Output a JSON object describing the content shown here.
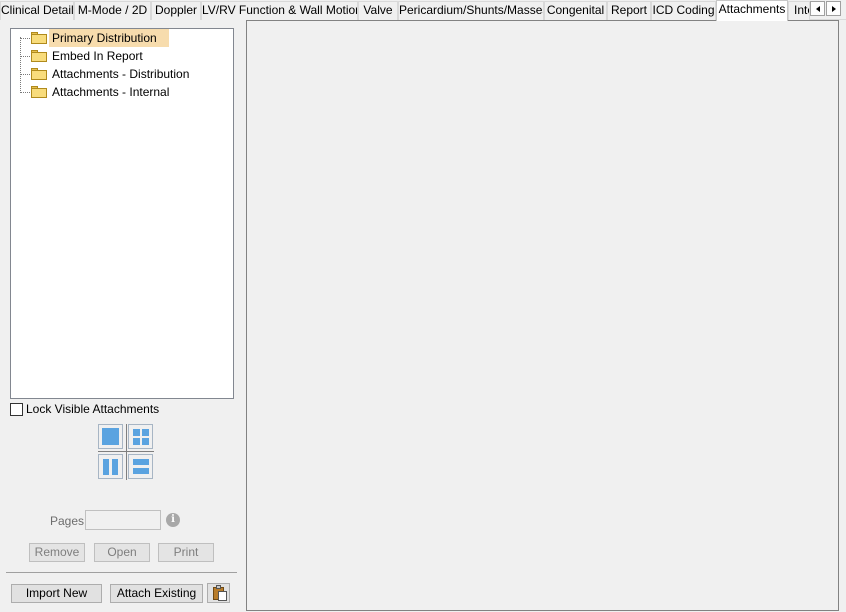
{
  "tabs": [
    {
      "label": "Clinical Detail",
      "active": false
    },
    {
      "label": "M-Mode / 2D",
      "active": false
    },
    {
      "label": "Doppler",
      "active": false
    },
    {
      "label": "LV/RV Function & Wall Motion",
      "active": false
    },
    {
      "label": "Valve",
      "active": false
    },
    {
      "label": "Pericardium/Shunts/Masses",
      "active": false
    },
    {
      "label": "Congenital",
      "active": false
    },
    {
      "label": "Report",
      "active": false
    },
    {
      "label": "ICD Coding",
      "active": false
    },
    {
      "label": "Attachments",
      "active": true
    },
    {
      "label": "Inte",
      "active": false
    }
  ],
  "tree": {
    "items": [
      {
        "label": "Primary Distribution",
        "icon": "folder-icon",
        "selected": true
      },
      {
        "label": "Embed In Report",
        "icon": "folder-icon",
        "selected": false
      },
      {
        "label": "Attachments - Distribution",
        "icon": "folder-icon",
        "selected": false
      },
      {
        "label": "Attachments - Internal",
        "icon": "folder-icon",
        "selected": false
      }
    ]
  },
  "lock": {
    "label": "Lock Visible Attachments",
    "checked": false
  },
  "layout_icons": [
    "single-view-icon",
    "grid-view-icon",
    "vertical-split-icon",
    "horizontal-split-icon"
  ],
  "pages": {
    "label": "Pages",
    "value": "",
    "info_icon": "info-icon"
  },
  "actions": {
    "remove": "Remove",
    "open": "Open",
    "print": "Print"
  },
  "bottom": {
    "import_new": "Import New",
    "attach_existing": "Attach Existing",
    "clipboard_icon": "paste-from-clipboard-icon"
  },
  "colors": {
    "selection": "#f7dcad",
    "layout_blue": "#5aa3e0",
    "folder": "#f8dc7c"
  }
}
